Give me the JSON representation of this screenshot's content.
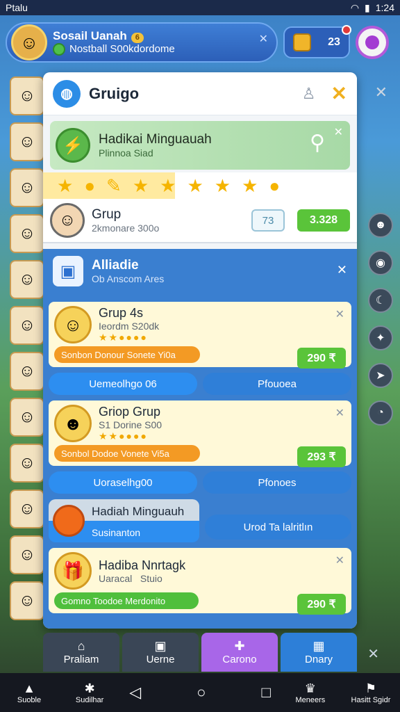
{
  "status": {
    "carrier": "Ptalu",
    "time": "1:24"
  },
  "profile": {
    "name": "Sosail Uanah",
    "level": "6",
    "subtitle": "Nostball S00kdordome"
  },
  "coins": {
    "count": "23"
  },
  "panel": {
    "title": "Gruigo",
    "banner": {
      "title": "Hadikai Minguauah",
      "subtitle": "Plinnoa Siad"
    },
    "group": {
      "title": "Grup",
      "subtitle": "2kmonare 300o",
      "val_a": "73",
      "val_b": "3.328"
    },
    "section": {
      "title": "Alliadie",
      "subtitle": "Ob Anscom Ares"
    },
    "cards": [
      {
        "name": "Grup 4s",
        "sub": "Ieordm S20dk",
        "bar": "Sonbon Donour Sonete Yi0a",
        "price": "290 ₹"
      },
      {
        "name": "Griop Grup",
        "sub": "S1 Dorine S00",
        "bar": "Sonbol Dodoe Vonete Vi5a",
        "price": "293 ₹"
      }
    ],
    "buttons": [
      {
        "left": "Uemeolhgo 06",
        "right": "Pfouoea"
      },
      {
        "left": "Uoraselhg00",
        "right": "Pfonoes"
      }
    ],
    "special": {
      "title": "Hadiah Minguauh",
      "subtitle": "Susinanton",
      "button": "Urod Ta lalritlın"
    },
    "last_card": {
      "name": "Hadiba Nnrtagk",
      "sub": "Uaracal",
      "sub2": "Stuio",
      "bar": "Gomno Toodoe Merdonito",
      "price": "290 ₹"
    }
  },
  "bottom_nav": [
    "Praliam",
    "Uerne",
    "Carono",
    "Dnary"
  ],
  "sysnav": {
    "left1": "Suoble",
    "left2": "Sudilhar",
    "right1": "Meneers",
    "right2": "Hasitt Sgidr"
  }
}
